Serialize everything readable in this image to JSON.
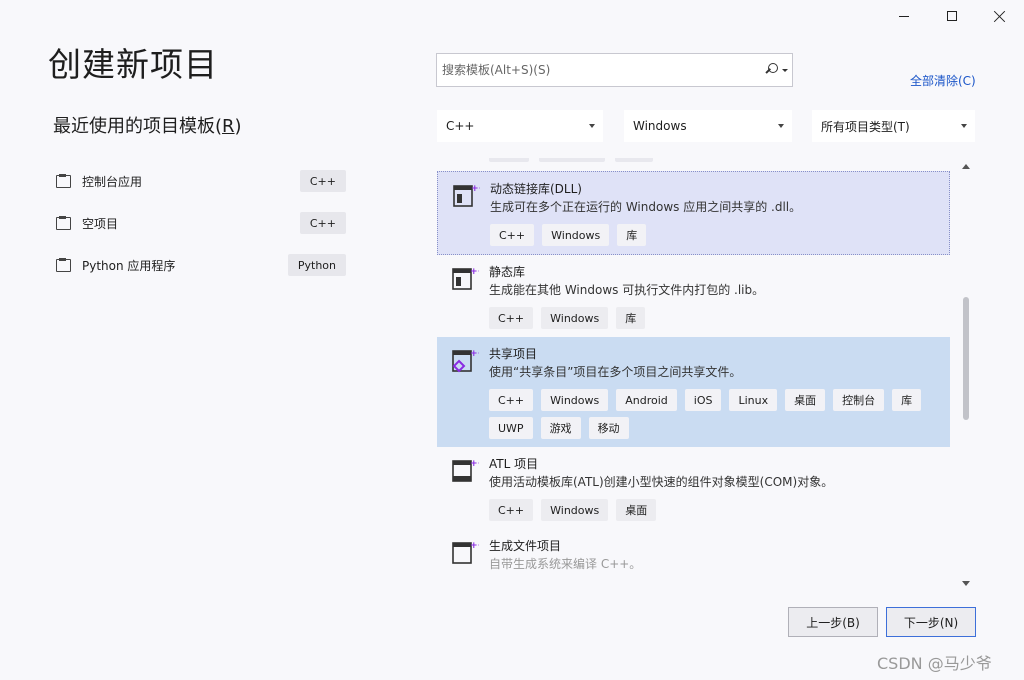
{
  "header": {
    "title": "创建新项目"
  },
  "recent": {
    "title_text": "最近使用的项目模板(",
    "title_key": "R",
    "title_end": ")",
    "items": [
      {
        "label": "控制台应用",
        "tag": "C++",
        "icon": "console-app-icon"
      },
      {
        "label": "空项目",
        "tag": "C++",
        "icon": "empty-project-icon"
      },
      {
        "label": "Python 应用程序",
        "tag": "Python",
        "icon": "python-app-icon"
      }
    ]
  },
  "search": {
    "placeholder": "搜索模板(Alt+S)(S)"
  },
  "clear_all": "全部清除(C)",
  "filters": {
    "language": "C++",
    "platform": "Windows",
    "project_type": "所有项目类型(T)"
  },
  "templates": [
    {
      "name": "动态链接库(DLL)",
      "desc": "生成可在多个正在运行的 Windows 应用之间共享的 .dll。",
      "tags": [
        "C++",
        "Windows",
        "库"
      ],
      "state": "selected",
      "icon": "dll-icon"
    },
    {
      "name": "静态库",
      "desc": "生成能在其他 Windows 可执行文件内打包的 .lib。",
      "tags": [
        "C++",
        "Windows",
        "库"
      ],
      "state": "",
      "icon": "static-lib-icon"
    },
    {
      "name": "共享项目",
      "desc": "使用“共享条目”项目在多个项目之间共享文件。",
      "tags": [
        "C++",
        "Windows",
        "Android",
        "iOS",
        "Linux",
        "桌面",
        "控制台",
        "库",
        "UWP",
        "游戏",
        "移动"
      ],
      "state": "hover",
      "icon": "shared-project-icon"
    },
    {
      "name": "ATL 项目",
      "desc": "使用活动模板库(ATL)创建小型快速的组件对象模型(COM)对象。",
      "tags": [
        "C++",
        "Windows",
        "桌面"
      ],
      "state": "",
      "icon": "atl-project-icon"
    },
    {
      "name": "生成文件项目",
      "desc": "自带生成系统来编译 C++。",
      "tags": [],
      "state": "fade",
      "icon": "makefile-project-icon"
    }
  ],
  "buttons": {
    "back": "上一步(B)",
    "next": "下一步(N)"
  },
  "watermark": "CSDN @马少爷",
  "colors": {
    "accent": "#1a55c8",
    "selected_bg": "#dfe2f7",
    "hover_bg": "#cadcf2",
    "icon_purple": "#8a2be2"
  }
}
